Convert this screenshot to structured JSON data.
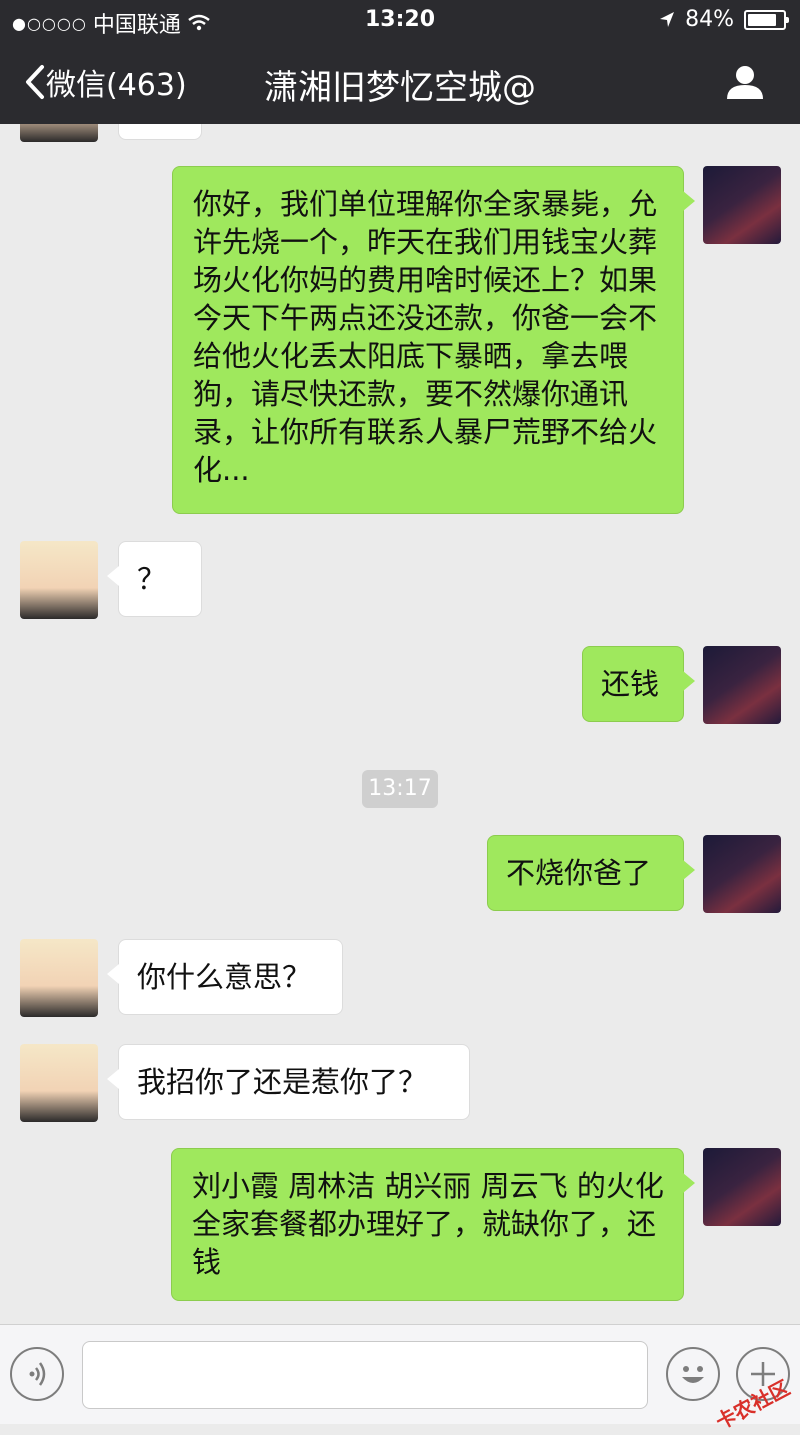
{
  "status_bar": {
    "signal": "●○○○○",
    "carrier": "中国联通",
    "time": "13:20",
    "battery": "84%"
  },
  "nav": {
    "back_label": "微信(463)",
    "title": "潇湘旧梦忆空城@"
  },
  "messages": [
    {
      "side": "out",
      "text": "你好，我们单位理解你全家暴毙，允许先烧一个，昨天在我们用钱宝火葬场火化你妈的费用啥时候还上？如果今天下午两点还没还款，你爸一会不给他火化丢太阳底下暴晒，拿去喂狗，请尽快还款，要不然爆你通讯录，让你所有联系人暴尸荒野不给火化..."
    },
    {
      "side": "in",
      "text": "？"
    },
    {
      "side": "out",
      "text": "还钱"
    },
    {
      "side": "out",
      "text": "不烧你爸了"
    },
    {
      "side": "in",
      "text": "你什么意思？"
    },
    {
      "side": "in",
      "text": "我招你了还是惹你了？"
    },
    {
      "side": "out",
      "text": "刘小霞 周林洁 胡兴丽 周云飞 的火化全家套餐都办理好了，就缺你了，还钱"
    }
  ],
  "timestamp": "13:17",
  "watermark": "卡农社区",
  "colors": {
    "bar": "#2b2b2f",
    "bubble_out": "#9fe85d",
    "bubble_in": "#ffffff",
    "background": "#ebebeb"
  }
}
